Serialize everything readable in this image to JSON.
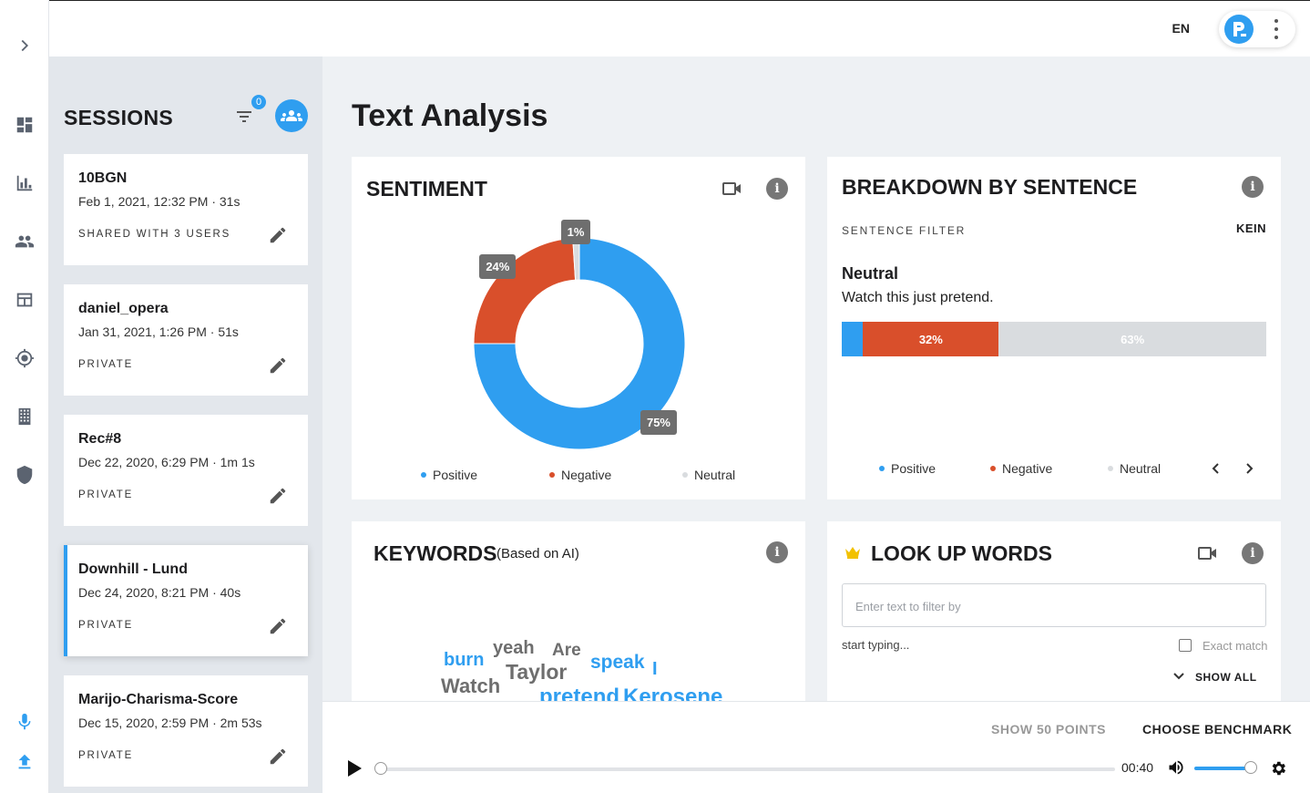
{
  "topbar": {
    "language": "EN"
  },
  "sessions": {
    "title": "SESSIONS",
    "filter_count": "0",
    "items": [
      {
        "name": "10BGN",
        "date": "Feb 1, 2021, 12:32 PM  ·  31s",
        "sharing": "SHARED WITH 3 USERS"
      },
      {
        "name": "daniel_opera",
        "date": "Jan 31, 2021, 1:26 PM  ·  51s",
        "sharing": "PRIVATE"
      },
      {
        "name": "Rec#8",
        "date": "Dec 22, 2020, 6:29 PM  ·  1m 1s",
        "sharing": "PRIVATE"
      },
      {
        "name": "Downhill - Lund",
        "date": "Dec 24, 2020, 8:21 PM  ·  40s",
        "sharing": "PRIVATE"
      },
      {
        "name": "Marijo-Charisma-Score",
        "date": "Dec 15, 2020, 2:59 PM  ·  2m 53s",
        "sharing": "PRIVATE"
      }
    ]
  },
  "main": {
    "title": "Text Analysis"
  },
  "sentiment": {
    "title": "SENTIMENT",
    "legend": [
      "Positive",
      "Negative",
      "Neutral"
    ]
  },
  "breakdown": {
    "title": "BREAKDOWN BY SENTENCE",
    "filter_label": "SENTENCE FILTER",
    "filter_value": "KEIN",
    "sentence_sentiment": "Neutral",
    "sentence_text": "Watch this just pretend.",
    "legend": [
      "Positive",
      "Negative",
      "Neutral"
    ]
  },
  "keywords": {
    "title": "KEYWORDS",
    "subtitle": "(Based on AI)",
    "words": [
      "burn",
      "yeah",
      "Are",
      "speak",
      "I",
      "Taylor",
      "Watch",
      "pretend",
      "Kerosene"
    ]
  },
  "lookup": {
    "title": "LOOK UP WORDS",
    "placeholder": "Enter text to filter by",
    "hint": "start typing...",
    "exact_match": "Exact match",
    "show_all": "SHOW ALL"
  },
  "player": {
    "show_points": "SHOW 50 POINTS",
    "choose_benchmark": "CHOOSE BENCHMARK",
    "time": "00:40"
  },
  "colors": {
    "positive": "#2f9ef0",
    "negative": "#d94f2b",
    "neutral": "#d9dcdf",
    "accent": "#2f9ef0"
  },
  "chart_data": [
    {
      "type": "pie",
      "categories": [
        "Positive",
        "Negative",
        "Neutral"
      ],
      "values": [
        75,
        24,
        1
      ],
      "labels": [
        "75%",
        "24%",
        "1%"
      ]
    },
    {
      "type": "bar",
      "categories": [
        "Positive",
        "Negative",
        "Neutral"
      ],
      "values": [
        5,
        32,
        63
      ],
      "labels": [
        "",
        "32%",
        "63%"
      ]
    }
  ]
}
